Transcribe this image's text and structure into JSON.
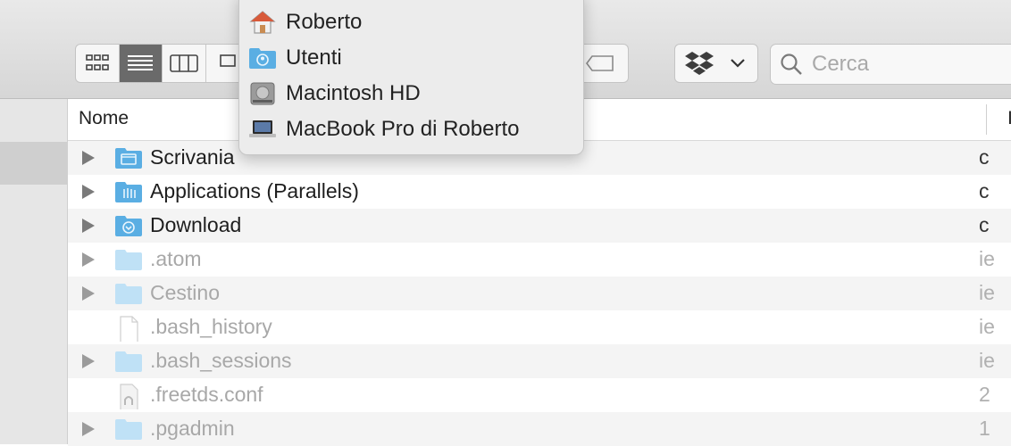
{
  "toolbar": {
    "view_buttons": [
      "icon-view",
      "list-view",
      "column-view",
      "gallery-view"
    ],
    "active_view": "list-view",
    "search_placeholder": "Cerca"
  },
  "path_menu": {
    "items": [
      {
        "label": "Roberto",
        "icon": "home-icon"
      },
      {
        "label": "Utenti",
        "icon": "users-folder-icon"
      },
      {
        "label": "Macintosh HD",
        "icon": "hard-drive-icon"
      },
      {
        "label": "MacBook Pro di Roberto",
        "icon": "laptop-icon"
      }
    ]
  },
  "list": {
    "columns": [
      "Nome",
      "I"
    ],
    "rows": [
      {
        "name": "Scrivania",
        "icon": "desktop-folder-icon",
        "expandable": true,
        "dim": false,
        "right": "c"
      },
      {
        "name": "Applications (Parallels)",
        "icon": "applications-folder-icon",
        "expandable": true,
        "dim": false,
        "right": "c"
      },
      {
        "name": "Download",
        "icon": "downloads-folder-icon",
        "expandable": true,
        "dim": false,
        "right": "c"
      },
      {
        "name": ".atom",
        "icon": "folder-icon",
        "expandable": true,
        "dim": true,
        "right": "ie"
      },
      {
        "name": "Cestino",
        "icon": "folder-icon",
        "expandable": true,
        "dim": true,
        "right": "ie"
      },
      {
        "name": ".bash_history",
        "icon": "document-icon",
        "expandable": false,
        "dim": true,
        "right": "ie"
      },
      {
        "name": ".bash_sessions",
        "icon": "folder-icon",
        "expandable": true,
        "dim": true,
        "right": "ie"
      },
      {
        "name": ".freetds.conf",
        "icon": "config-file-icon",
        "expandable": false,
        "dim": true,
        "right": "2"
      },
      {
        "name": ".pgadmin",
        "icon": "folder-icon",
        "expandable": true,
        "dim": true,
        "right": "1"
      }
    ]
  },
  "colors": {
    "folder_blue": "#5aaee3",
    "folder_light": "#bfe1f6",
    "active_segment": "#6a6a6a"
  }
}
